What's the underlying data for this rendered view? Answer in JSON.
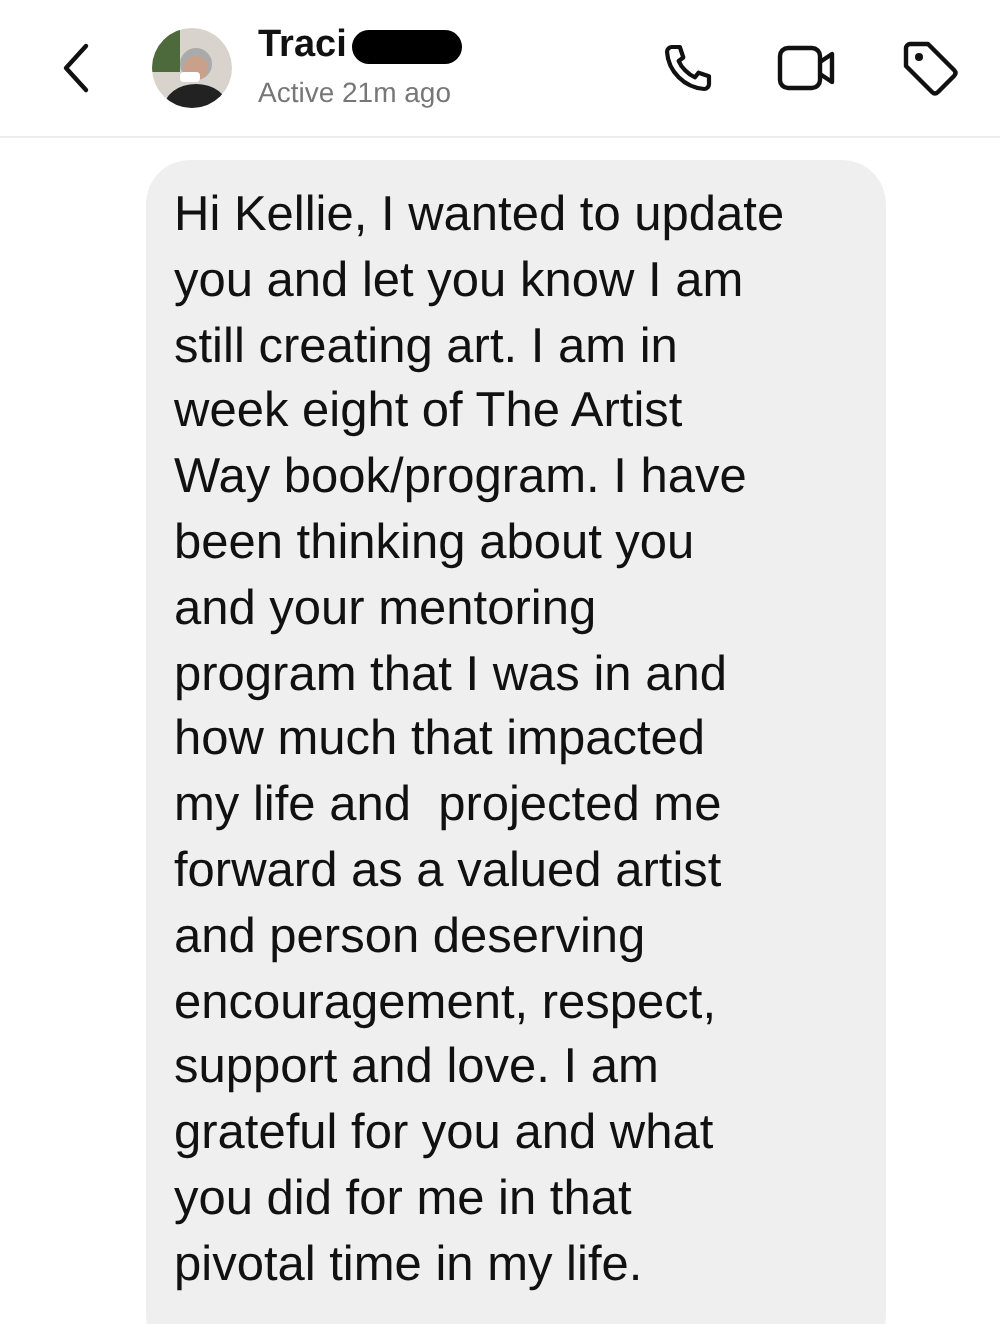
{
  "header": {
    "name": "Traci",
    "status": "Active 21m ago"
  },
  "message": {
    "lines": [
      "Hi Kellie, I wanted to update",
      "you and let you know I am",
      "still creating art. I am in",
      "week eight of The Artist",
      "Way book/program. I have",
      "been thinking about you",
      "and your mentoring",
      "program that I was in and",
      "how much that impacted",
      "my life and  projected me",
      "forward as a valued artist",
      "and person deserving",
      "encouragement, respect,",
      "support and love. I am",
      "grateful for you and what",
      "you did for me in that",
      "pivotal time in my life."
    ]
  }
}
